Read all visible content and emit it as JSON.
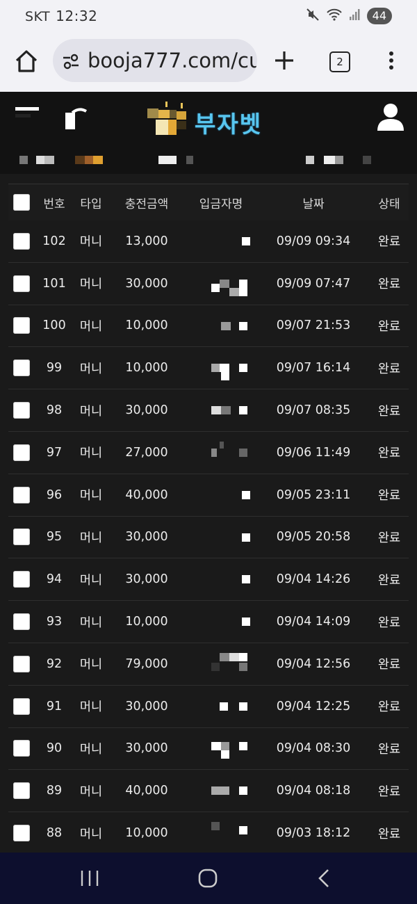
{
  "status_bar": {
    "carrier": "SKT",
    "time": "12:32",
    "battery": "44"
  },
  "browser": {
    "url": "booja777.com/cu",
    "tab_count": "2"
  },
  "site": {
    "logo_text": "부자벳"
  },
  "table": {
    "headers": {
      "no": "번호",
      "type": "타입",
      "amount": "충전금액",
      "depositor": "입금자명",
      "date": "날짜",
      "status": "상태"
    },
    "rows": [
      {
        "no": "102",
        "type": "머니",
        "amount": "13,000",
        "date": "09/09 09:34",
        "status": "완료"
      },
      {
        "no": "101",
        "type": "머니",
        "amount": "30,000",
        "date": "09/09 07:47",
        "status": "완료"
      },
      {
        "no": "100",
        "type": "머니",
        "amount": "10,000",
        "date": "09/07 21:53",
        "status": "완료"
      },
      {
        "no": "99",
        "type": "머니",
        "amount": "10,000",
        "date": "09/07 16:14",
        "status": "완료"
      },
      {
        "no": "98",
        "type": "머니",
        "amount": "30,000",
        "date": "09/07 08:35",
        "status": "완료"
      },
      {
        "no": "97",
        "type": "머니",
        "amount": "27,000",
        "date": "09/06 11:49",
        "status": "완료"
      },
      {
        "no": "96",
        "type": "머니",
        "amount": "40,000",
        "date": "09/05 23:11",
        "status": "완료"
      },
      {
        "no": "95",
        "type": "머니",
        "amount": "30,000",
        "date": "09/05 20:58",
        "status": "완료"
      },
      {
        "no": "94",
        "type": "머니",
        "amount": "30,000",
        "date": "09/04 14:26",
        "status": "완료"
      },
      {
        "no": "93",
        "type": "머니",
        "amount": "10,000",
        "date": "09/04 14:09",
        "status": "완료"
      },
      {
        "no": "92",
        "type": "머니",
        "amount": "79,000",
        "date": "09/04 12:56",
        "status": "완료"
      },
      {
        "no": "91",
        "type": "머니",
        "amount": "30,000",
        "date": "09/04 12:25",
        "status": "완료"
      },
      {
        "no": "90",
        "type": "머니",
        "amount": "30,000",
        "date": "09/04 08:30",
        "status": "완료"
      },
      {
        "no": "89",
        "type": "머니",
        "amount": "40,000",
        "date": "09/04 08:18",
        "status": "완료"
      },
      {
        "no": "88",
        "type": "머니",
        "amount": "10,000",
        "date": "09/03 18:12",
        "status": "완료"
      }
    ]
  },
  "icons": {
    "home": "home-icon",
    "site_settings": "tune-icon",
    "new_tab": "plus-icon",
    "menu": "more-vert-icon",
    "user": "user-icon"
  }
}
